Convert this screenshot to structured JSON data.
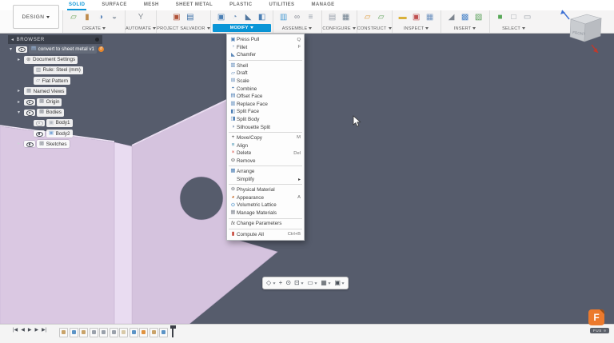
{
  "design_menu": {
    "label": "DESIGN"
  },
  "tabs": [
    {
      "label": "SOLID",
      "active": true
    },
    {
      "label": "SURFACE"
    },
    {
      "label": "MESH"
    },
    {
      "label": "SHEET METAL"
    },
    {
      "label": "PLASTIC"
    },
    {
      "label": "UTILITIES"
    },
    {
      "label": "MANAGE"
    }
  ],
  "toolbar": {
    "groups": [
      {
        "name": "create",
        "label": "CREATE",
        "icons": [
          {
            "name": "create-sketch-icon",
            "glyph": "▱",
            "color": "#6aa257"
          },
          {
            "name": "extrude-icon",
            "glyph": "▮",
            "color": "#bf8a4a"
          },
          {
            "name": "revolve-icon",
            "glyph": "◑",
            "color": "#628bbd"
          },
          {
            "name": "form-icon",
            "glyph": "◒",
            "color": "#97a0ab"
          }
        ]
      },
      {
        "name": "automate",
        "label": "AUTOMATE",
        "icons": [
          {
            "name": "automate-icon",
            "glyph": "Y",
            "color": "#8a9097"
          }
        ]
      },
      {
        "name": "project-salvador",
        "label": "PROJECT SALVADOR",
        "icons": [
          {
            "name": "project-tool-icon-1",
            "glyph": "▣",
            "color": "#b05238"
          },
          {
            "name": "project-tool-icon-2",
            "glyph": "▤",
            "color": "#3f72a8"
          }
        ]
      },
      {
        "name": "modify",
        "label": "MODIFY",
        "highlighted": true,
        "icons": [
          {
            "name": "press-pull-icon",
            "glyph": "▣",
            "color": "#4b7fb4"
          },
          {
            "name": "fillet-icon",
            "glyph": "◔",
            "color": "#6d90ba"
          },
          {
            "name": "chamfer-icon",
            "glyph": "◣",
            "color": "#52779f"
          },
          {
            "name": "combine-icon",
            "glyph": "◧",
            "color": "#4b7fb4"
          }
        ]
      },
      {
        "name": "assemble",
        "label": "ASSEMBLE",
        "icons": [
          {
            "name": "new-component-icon",
            "glyph": "▥",
            "color": "#4b9cd3"
          },
          {
            "name": "joint-icon",
            "glyph": "∞",
            "color": "#8a8f98"
          },
          {
            "name": "bom-icon",
            "glyph": "≡",
            "color": "#98a0ab"
          }
        ]
      },
      {
        "name": "configure",
        "label": "CONFIGURE",
        "icons": [
          {
            "name": "configuration-icon",
            "glyph": "▤",
            "color": "#9aa2ad"
          },
          {
            "name": "configuration-table-icon",
            "glyph": "▦",
            "color": "#70808f"
          }
        ]
      },
      {
        "name": "construct",
        "label": "CONSTRUCT",
        "icons": [
          {
            "name": "offset-plane-icon",
            "glyph": "▱",
            "color": "#e09a3c"
          },
          {
            "name": "angled-plane-icon",
            "glyph": "▱",
            "color": "#62a35c"
          }
        ]
      },
      {
        "name": "inspect",
        "label": "INSPECT",
        "icons": [
          {
            "name": "measure-icon",
            "glyph": "▬",
            "color": "#d9b13b"
          },
          {
            "name": "interference-icon",
            "glyph": "▣",
            "color": "#c05050"
          },
          {
            "name": "section-analysis-icon",
            "glyph": "▦",
            "color": "#6f93c0"
          }
        ]
      },
      {
        "name": "insert",
        "label": "INSERT",
        "icons": [
          {
            "name": "decal-icon",
            "glyph": "◢",
            "color": "#7d858f"
          },
          {
            "name": "insert-mesh-icon",
            "glyph": "▩",
            "color": "#4d86c9"
          },
          {
            "name": "insert-svg-icon",
            "glyph": "▧",
            "color": "#5aa05a"
          }
        ]
      },
      {
        "name": "select",
        "label": "SELECT",
        "icons": [
          {
            "name": "select-solid-icon",
            "glyph": "■",
            "color": "#58a858"
          },
          {
            "name": "select-body-icon",
            "glyph": "□",
            "color": "#9aa0a8"
          },
          {
            "name": "select-window-icon",
            "glyph": "▭",
            "color": "#9aa0a8"
          }
        ]
      }
    ]
  },
  "modify_menu": {
    "items": [
      {
        "label": "Press Pull",
        "shortcut": "Q",
        "icon": {
          "name": "press-pull-icon",
          "glyph": "▣",
          "color": "#4d7fb5"
        }
      },
      {
        "label": "Fillet",
        "shortcut": "F",
        "icon": {
          "name": "fillet-icon",
          "glyph": "◔",
          "color": "#5c87b8"
        }
      },
      {
        "label": "Chamfer",
        "icon": {
          "name": "chamfer-icon",
          "glyph": "◣",
          "color": "#5c87b8"
        }
      },
      {
        "divider": true
      },
      {
        "label": "Shell",
        "icon": {
          "name": "shell-icon",
          "glyph": "▥",
          "color": "#5c87b8"
        }
      },
      {
        "label": "Draft",
        "icon": {
          "name": "draft-icon",
          "glyph": "▱",
          "color": "#5c87b8"
        }
      },
      {
        "label": "Scale",
        "icon": {
          "name": "scale-icon",
          "glyph": "⊞",
          "color": "#5c87b8"
        }
      },
      {
        "label": "Combine",
        "icon": {
          "name": "combine-icon",
          "glyph": "◓",
          "color": "#4d7fb5"
        }
      },
      {
        "label": "Offset Face",
        "icon": {
          "name": "offset-face-icon",
          "glyph": "▤",
          "color": "#4d7fb5"
        }
      },
      {
        "label": "Replace Face",
        "icon": {
          "name": "replace-face-icon",
          "glyph": "▥",
          "color": "#4d7fb5"
        }
      },
      {
        "label": "Split Face",
        "icon": {
          "name": "split-face-icon",
          "glyph": "◧",
          "color": "#4d7fb5"
        }
      },
      {
        "label": "Split Body",
        "icon": {
          "name": "split-body-icon",
          "glyph": "◨",
          "color": "#4d7fb5"
        }
      },
      {
        "label": "Silhouette Split",
        "icon": {
          "name": "silhouette-split-icon",
          "glyph": "◑",
          "color": "#6d86a8"
        }
      },
      {
        "divider": true
      },
      {
        "label": "Move/Copy",
        "shortcut": "M",
        "icon": {
          "name": "move-copy-icon",
          "glyph": "+",
          "color": "#3a3a3a"
        }
      },
      {
        "label": "Align",
        "icon": {
          "name": "align-icon",
          "glyph": "≡",
          "color": "#3f8fae"
        }
      },
      {
        "label": "Delete",
        "shortcut": "Del",
        "icon": {
          "name": "delete-icon",
          "glyph": "×",
          "color": "#d43b2f"
        }
      },
      {
        "label": "Remove",
        "icon": {
          "name": "remove-icon",
          "glyph": "⊖",
          "color": "#555555"
        }
      },
      {
        "divider": true
      },
      {
        "label": "Arrange",
        "icon": {
          "name": "arrange-icon",
          "glyph": "▦",
          "color": "#4d7fb5"
        }
      },
      {
        "label": "Simplify",
        "submenu": true
      },
      {
        "divider": true
      },
      {
        "label": "Physical Material",
        "icon": {
          "name": "physical-material-icon",
          "glyph": "⊛",
          "color": "#6a6f76"
        }
      },
      {
        "label": "Appearance",
        "shortcut": "A",
        "icon": {
          "name": "appearance-icon",
          "glyph": "◕",
          "color": "#c56a2b"
        }
      },
      {
        "label": "Volumetric Lattice",
        "icon": {
          "name": "volumetric-lattice-icon",
          "glyph": "⊙",
          "color": "#2e7fc2"
        }
      },
      {
        "label": "Manage Materials",
        "icon": {
          "name": "manage-materials-icon",
          "glyph": "▦",
          "color": "#8a8f98"
        }
      },
      {
        "divider": true
      },
      {
        "label": "Change Parameters",
        "icon": {
          "name": "change-parameters-icon",
          "glyph": "fx",
          "color": "#444444",
          "italic": true
        }
      },
      {
        "divider": true
      },
      {
        "label": "Compute All",
        "shortcut": "Ctrl+B",
        "icon": {
          "name": "compute-all-icon",
          "glyph": "▮",
          "color": "#c23b2e"
        }
      }
    ]
  },
  "browser": {
    "header": "BROWSER",
    "rows": [
      {
        "label": "convert to sheet metal v1",
        "indent": 0,
        "expander": "expanded",
        "eye": "visible",
        "selected": true,
        "badge": true,
        "icon": {
          "name": "design-document-icon",
          "glyph": "▤",
          "color": "#9fc0e8"
        }
      },
      {
        "label": "Document Settings",
        "indent": 1,
        "expander": "collapsed",
        "icon": {
          "name": "settings-gear-icon",
          "glyph": "⊛",
          "color": "#666666"
        }
      },
      {
        "label": "Rule: Steel (mm)",
        "indent": 2,
        "icon": {
          "name": "sheet-metal-rule-icon",
          "glyph": "▥",
          "color": "#8a8f98"
        }
      },
      {
        "label": "Flat Pattern",
        "indent": 2,
        "icon": {
          "name": "flat-pattern-icon",
          "glyph": "▱",
          "color": "#8a8f98"
        }
      },
      {
        "label": "Named Views",
        "indent": 1,
        "expander": "collapsed",
        "icon": {
          "name": "named-views-icon",
          "glyph": "▦",
          "color": "#8a8f98"
        }
      },
      {
        "label": "Origin",
        "indent": 1,
        "expander": "collapsed",
        "eye": "visible",
        "icon": {
          "name": "origin-folder-icon",
          "glyph": "▩",
          "color": "#8a8f98"
        }
      },
      {
        "label": "Bodies",
        "indent": 1,
        "expander": "expanded",
        "eye": "visible",
        "icon": {
          "name": "bodies-folder-icon",
          "glyph": "▩",
          "color": "#8a8f98"
        }
      },
      {
        "label": "Body1",
        "indent": 2,
        "eye": "hidden",
        "icon": {
          "name": "body-icon",
          "glyph": "▣",
          "color": "#b0b6bf"
        }
      },
      {
        "label": "Body2",
        "indent": 2,
        "eye": "visible",
        "icon": {
          "name": "body-icon",
          "glyph": "▣",
          "color": "#7aa7d8"
        }
      },
      {
        "label": "Sketches",
        "indent": 1,
        "expander": "collapsed",
        "eye": "visible",
        "icon": {
          "name": "sketches-folder-icon",
          "glyph": "▩",
          "color": "#8a8f98"
        }
      }
    ]
  },
  "viewcube": {
    "front_label": "FRONT"
  },
  "navbar": {
    "buttons": [
      {
        "name": "orbit-button",
        "glyph": "◇",
        "caret": true
      },
      {
        "name": "pan-button",
        "glyph": "+",
        "caret": false
      },
      {
        "name": "zoom-button",
        "glyph": "⊙",
        "caret": false
      },
      {
        "name": "zoom-window-button",
        "glyph": "⊡",
        "caret": true
      },
      {
        "name": "display-settings-button",
        "glyph": "▭",
        "caret": true
      },
      {
        "name": "grid-settings-button",
        "glyph": "▦",
        "caret": true
      },
      {
        "name": "viewports-button",
        "glyph": "▣",
        "caret": true
      }
    ]
  },
  "timeline": {
    "controls": [
      {
        "name": "go-to-start-button",
        "glyph": "|◀"
      },
      {
        "name": "step-back-button",
        "glyph": "◀"
      },
      {
        "name": "play-button",
        "glyph": "▶"
      },
      {
        "name": "step-forward-button",
        "glyph": "▶"
      },
      {
        "name": "go-to-end-button",
        "glyph": "▶|"
      }
    ],
    "features": [
      {
        "name": "timeline-sketch-1",
        "color": "#c9a36a"
      },
      {
        "name": "timeline-extrude-1",
        "color": "#5b93c6"
      },
      {
        "name": "timeline-sketch-2",
        "color": "#c9a36a"
      },
      {
        "name": "timeline-mirror",
        "color": "#9aa1ab"
      },
      {
        "name": "timeline-pattern",
        "color": "#9aa1ab"
      },
      {
        "name": "timeline-shell",
        "color": "#9aa1ab"
      },
      {
        "name": "timeline-sketch-3",
        "color": "#d8c9a8"
      },
      {
        "name": "timeline-extrude-2",
        "color": "#5b93c6"
      },
      {
        "name": "timeline-fillet",
        "color": "#e0923f"
      },
      {
        "name": "timeline-sketch-4",
        "color": "#c9a36a"
      },
      {
        "name": "timeline-flange",
        "color": "#5b93c6"
      }
    ]
  },
  "logo": {
    "letter": "F",
    "sub": "FUS"
  },
  "colors": {
    "accent_blue": "#0a96d7",
    "canvas_background": "#565c6c",
    "part_left_face": "#dac8e2",
    "part_main_face": "#d5c3de",
    "part_bend": "#e9dcf1",
    "selection_badge_orange": "#e8872a"
  }
}
